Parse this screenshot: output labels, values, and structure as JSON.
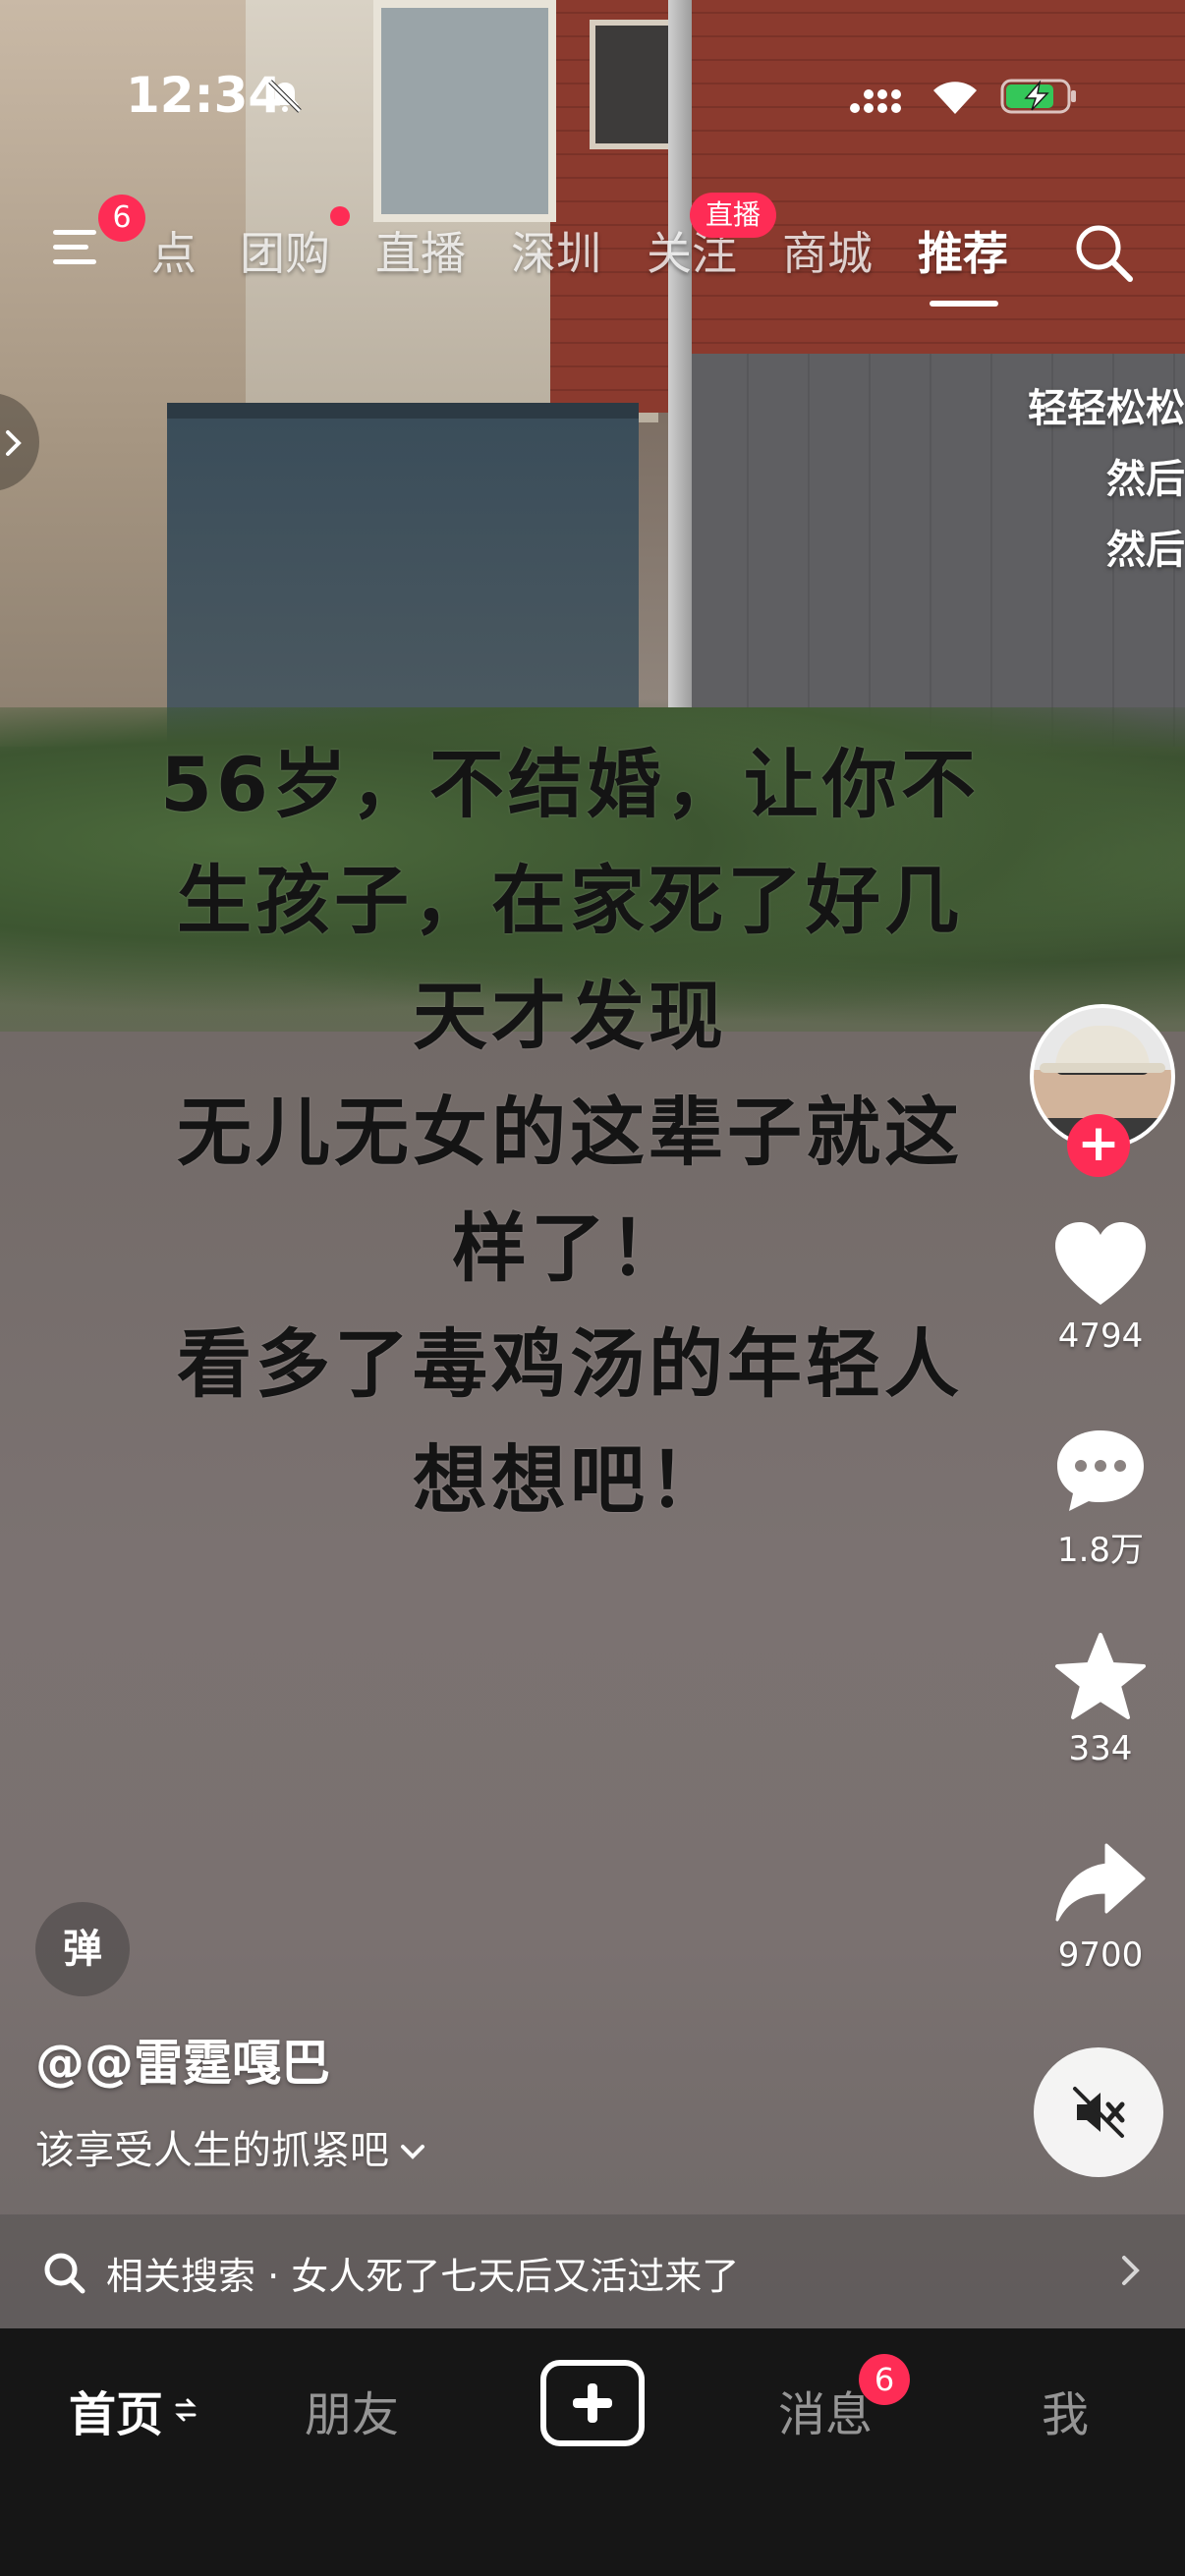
{
  "status_bar": {
    "time": "12:34"
  },
  "top_nav": {
    "menu_badge": "6",
    "tabs": [
      "点",
      "团购",
      "直播",
      "深圳",
      "关注",
      "商城",
      "推荐"
    ],
    "live_badge": "直播"
  },
  "video": {
    "caption": "56岁，不结婚，让你不\n生孩子，在家死了好几\n天才发现\n无儿无女的这辈子就这\n样了！\n看多了毒鸡汤的年轻人\n想想吧！",
    "side_caption": [
      "轻轻松松",
      "然后",
      "然后"
    ]
  },
  "rail": {
    "likes": "4794",
    "comments": "1.8万",
    "favorites": "334",
    "shares": "9700"
  },
  "info": {
    "danmu_label": "弹",
    "author": "@@雷霆嘎巴",
    "description": "该享受人生的抓紧吧"
  },
  "related_search": {
    "prefix": "相关搜索",
    "separator": "·",
    "query": "女人死了七天后又活过来了"
  },
  "tab_bar": {
    "home": "首页",
    "friends": "朋友",
    "messages": "消息",
    "messages_badge": "6",
    "me": "我"
  },
  "colors": {
    "accent": "#fe2c55",
    "tab_bar_bg": "#161616"
  },
  "icons": [
    "bell-off-icon",
    "signal-icon",
    "wifi-icon",
    "battery-charging-icon",
    "menu-icon",
    "search-icon",
    "chevron-right-icon",
    "heart-icon",
    "comment-icon",
    "star-icon",
    "share-icon",
    "mute-icon",
    "chevron-down-icon",
    "refresh-icon",
    "plus-icon"
  ]
}
